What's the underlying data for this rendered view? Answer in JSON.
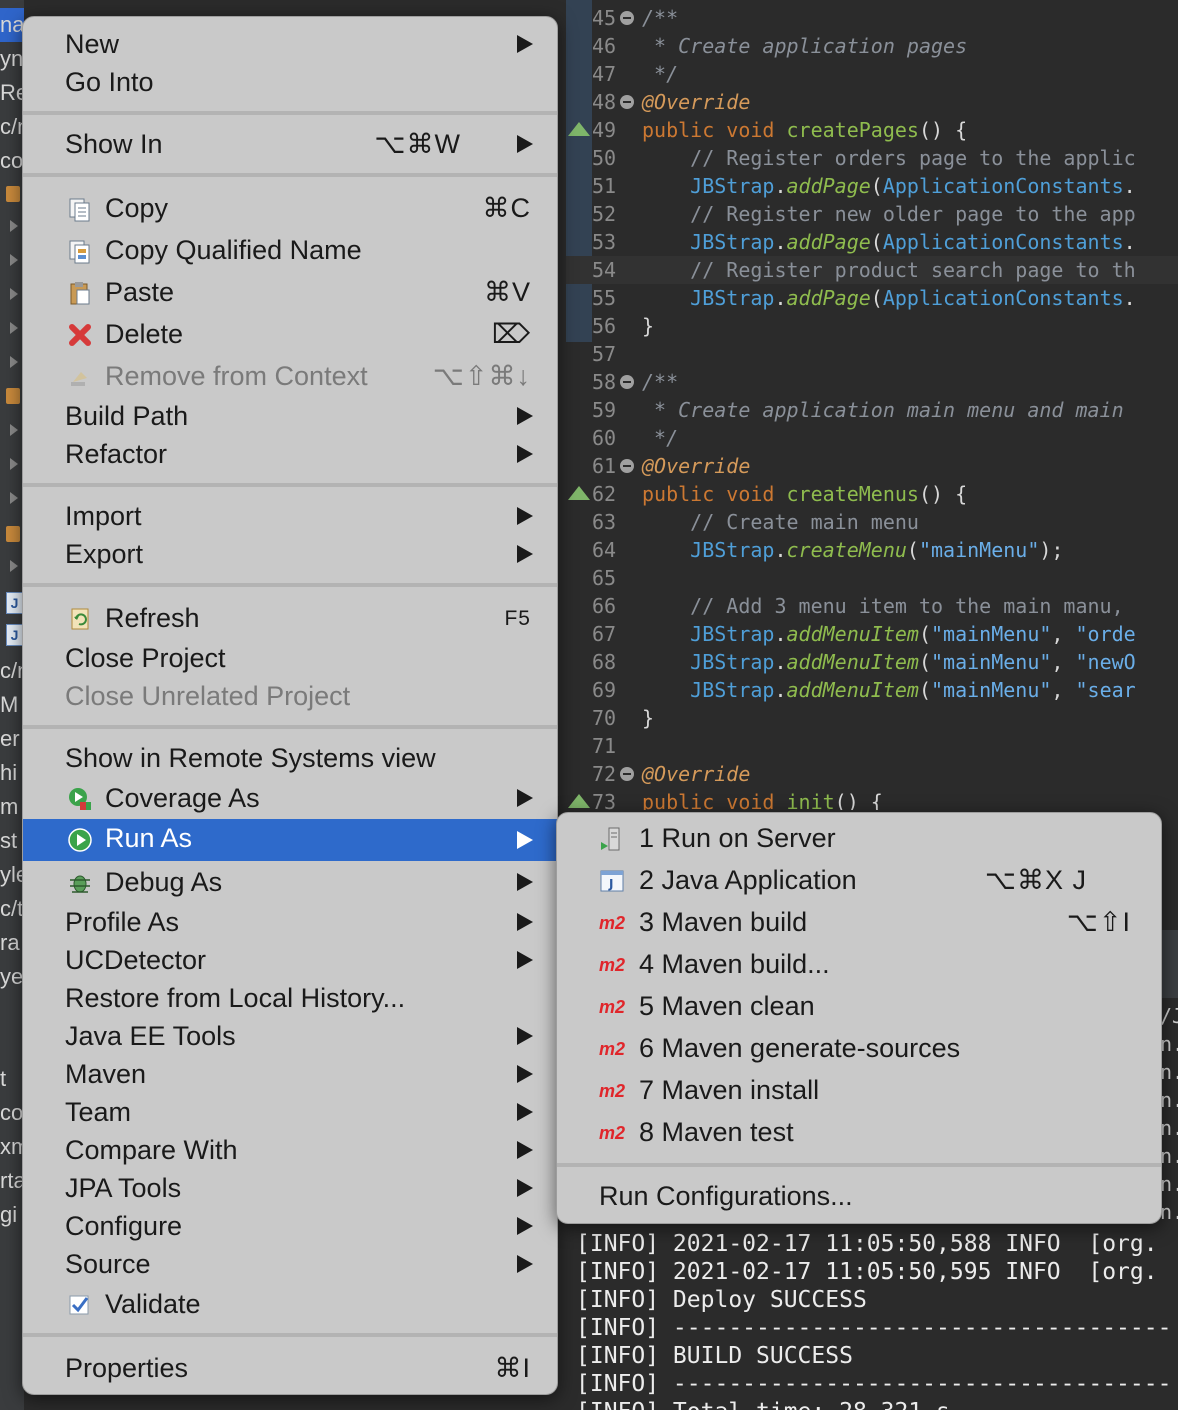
{
  "left_strip": {
    "fragments": [
      "na",
      "yn",
      "Re",
      "c/n",
      "co",
      "c/n",
      "M",
      "er",
      "hi",
      "m",
      "st",
      "yle",
      "c/t",
      "ra",
      "ye",
      "t",
      "cor",
      "xm",
      "rta",
      "gi"
    ]
  },
  "editor": {
    "lines": [
      {
        "n": "45",
        "fold": true,
        "ovr": false,
        "tokens": [
          [
            "c-doc",
            "/**"
          ]
        ]
      },
      {
        "n": "46",
        "tokens": [
          [
            "c-doc",
            " * Create application pages"
          ]
        ]
      },
      {
        "n": "47",
        "tokens": [
          [
            "c-doc",
            " */"
          ]
        ]
      },
      {
        "n": "48",
        "fold": true,
        "tokens": [
          [
            "c-ann",
            "@Override"
          ]
        ]
      },
      {
        "n": "49",
        "ovr": true,
        "tokens": [
          [
            "c-kw",
            "public void "
          ],
          [
            "c-fn",
            "createPages"
          ],
          [
            "c-plain",
            "() {"
          ]
        ]
      },
      {
        "n": "50",
        "tokens": [
          [
            "c-com",
            "    // Register orders page to the applic"
          ]
        ]
      },
      {
        "n": "51",
        "tokens": [
          [
            "c-cls",
            "    JBStrap"
          ],
          [
            "c-plain",
            "."
          ],
          [
            "c-mth",
            "addPage"
          ],
          [
            "c-plain",
            "("
          ],
          [
            "c-cls",
            "ApplicationConstants"
          ],
          [
            "c-plain",
            "."
          ]
        ]
      },
      {
        "n": "52",
        "tokens": [
          [
            "c-com",
            "    // Register new older page to the app"
          ]
        ]
      },
      {
        "n": "53",
        "tokens": [
          [
            "c-cls",
            "    JBStrap"
          ],
          [
            "c-plain",
            "."
          ],
          [
            "c-mth",
            "addPage"
          ],
          [
            "c-plain",
            "("
          ],
          [
            "c-cls",
            "ApplicationConstants"
          ],
          [
            "c-plain",
            "."
          ]
        ]
      },
      {
        "n": "54",
        "hl": true,
        "tokens": [
          [
            "c-com",
            "    // Register product search page to th"
          ]
        ]
      },
      {
        "n": "55",
        "tokens": [
          [
            "c-cls",
            "    JBStrap"
          ],
          [
            "c-plain",
            "."
          ],
          [
            "c-mth",
            "addPage"
          ],
          [
            "c-plain",
            "("
          ],
          [
            "c-cls",
            "ApplicationConstants"
          ],
          [
            "c-plain",
            "."
          ]
        ]
      },
      {
        "n": "56",
        "tokens": [
          [
            "c-plain",
            "}"
          ]
        ]
      },
      {
        "n": "57",
        "tokens": []
      },
      {
        "n": "58",
        "fold": true,
        "tokens": [
          [
            "c-doc",
            "/**"
          ]
        ]
      },
      {
        "n": "59",
        "tokens": [
          [
            "c-doc",
            " * Create application main menu and main"
          ]
        ]
      },
      {
        "n": "60",
        "tokens": [
          [
            "c-doc",
            " */"
          ]
        ]
      },
      {
        "n": "61",
        "fold": true,
        "tokens": [
          [
            "c-ann",
            "@Override"
          ]
        ]
      },
      {
        "n": "62",
        "ovr": true,
        "tokens": [
          [
            "c-kw",
            "public void "
          ],
          [
            "c-fn",
            "createMenus"
          ],
          [
            "c-plain",
            "() {"
          ]
        ]
      },
      {
        "n": "63",
        "tokens": [
          [
            "c-com",
            "    // Create main menu"
          ]
        ]
      },
      {
        "n": "64",
        "tokens": [
          [
            "c-cls",
            "    JBStrap"
          ],
          [
            "c-plain",
            "."
          ],
          [
            "c-mth",
            "createMenu"
          ],
          [
            "c-plain",
            "("
          ],
          [
            "c-str",
            "\"mainMenu\""
          ],
          [
            "c-plain",
            ");"
          ]
        ]
      },
      {
        "n": "65",
        "tokens": []
      },
      {
        "n": "66",
        "tokens": [
          [
            "c-com",
            "    // Add 3 menu item to the main manu,"
          ]
        ]
      },
      {
        "n": "67",
        "tokens": [
          [
            "c-cls",
            "    JBStrap"
          ],
          [
            "c-plain",
            "."
          ],
          [
            "c-mth",
            "addMenuItem"
          ],
          [
            "c-plain",
            "("
          ],
          [
            "c-str",
            "\"mainMenu\""
          ],
          [
            "c-plain",
            ", "
          ],
          [
            "c-str",
            "\"orde"
          ]
        ]
      },
      {
        "n": "68",
        "tokens": [
          [
            "c-cls",
            "    JBStrap"
          ],
          [
            "c-plain",
            "."
          ],
          [
            "c-mth",
            "addMenuItem"
          ],
          [
            "c-plain",
            "("
          ],
          [
            "c-str",
            "\"mainMenu\""
          ],
          [
            "c-plain",
            ", "
          ],
          [
            "c-str",
            "\"newO"
          ]
        ]
      },
      {
        "n": "69",
        "tokens": [
          [
            "c-cls",
            "    JBStrap"
          ],
          [
            "c-plain",
            "."
          ],
          [
            "c-mth",
            "addMenuItem"
          ],
          [
            "c-plain",
            "("
          ],
          [
            "c-str",
            "\"mainMenu\""
          ],
          [
            "c-plain",
            ", "
          ],
          [
            "c-str",
            "\"sear"
          ]
        ]
      },
      {
        "n": "70",
        "tokens": [
          [
            "c-plain",
            "}"
          ]
        ]
      },
      {
        "n": "71",
        "tokens": []
      },
      {
        "n": "72",
        "fold": true,
        "tokens": [
          [
            "c-ann",
            "@Override"
          ]
        ]
      },
      {
        "n": "73",
        "ovr": true,
        "tokens": [
          [
            "c-kw",
            "public void "
          ],
          [
            "c-fn",
            "init"
          ],
          [
            "c-plain",
            "() {"
          ]
        ]
      }
    ]
  },
  "console": {
    "lines": [
      "[INFO] 2021-02-17 11:05:50,588 INFO  [org.",
      "[INFO] 2021-02-17 11:05:50,595 INFO  [org.",
      "[INFO] Deploy SUCCESS",
      "[INFO] ------------------------------------",
      "[INFO] BUILD SUCCESS",
      "[INFO] ------------------------------------",
      "[INFO] Total time: 28.321 s"
    ],
    "edge_fragments": [
      "/J",
      "n.",
      "n.",
      "n.",
      "n.",
      "n.",
      "n.",
      "n."
    ]
  },
  "context_menu": {
    "new": "New",
    "go_into": "Go Into",
    "show_in": "Show In",
    "show_in_shortcut": "⌥⌘W",
    "copy": "Copy",
    "copy_shortcut": "⌘C",
    "copy_qualified_name": "Copy Qualified Name",
    "paste": "Paste",
    "paste_shortcut": "⌘V",
    "delete": "Delete",
    "delete_shortcut": "⌦",
    "remove_from_context": "Remove from Context",
    "remove_shortcut": "⌥⇧⌘↓",
    "build_path": "Build Path",
    "refactor": "Refactor",
    "import": "Import",
    "export": "Export",
    "refresh": "Refresh",
    "refresh_shortcut": "F5",
    "close_project": "Close Project",
    "close_unrelated_project": "Close Unrelated Project",
    "show_remote": "Show in Remote Systems view",
    "coverage_as": "Coverage As",
    "run_as": "Run As",
    "debug_as": "Debug As",
    "profile_as": "Profile As",
    "ucdetector": "UCDetector",
    "restore_history": "Restore from Local History...",
    "java_ee_tools": "Java EE Tools",
    "maven": "Maven",
    "team": "Team",
    "compare_with": "Compare With",
    "jpa_tools": "JPA Tools",
    "configure": "Configure",
    "source": "Source",
    "validate": "Validate",
    "properties": "Properties",
    "properties_shortcut": "⌘I"
  },
  "run_as_submenu": {
    "run_on_server": "1 Run on Server",
    "java_application": "2 Java Application",
    "java_application_shortcut": "⌥⌘X J",
    "maven_build": "3 Maven build",
    "maven_build_shortcut": "⌥⇧I",
    "maven_build_dots": "4 Maven build...",
    "maven_clean": "5 Maven clean",
    "maven_generate_sources": "6 Maven generate-sources",
    "maven_install": "7 Maven install",
    "maven_test": "8 Maven test",
    "run_configurations": "Run Configurations...",
    "m2_badge": "m2"
  },
  "colors": {
    "selection": "#2e6acb",
    "menu_bg": "#c9c9c9",
    "editor_bg": "#2b2b2b"
  }
}
